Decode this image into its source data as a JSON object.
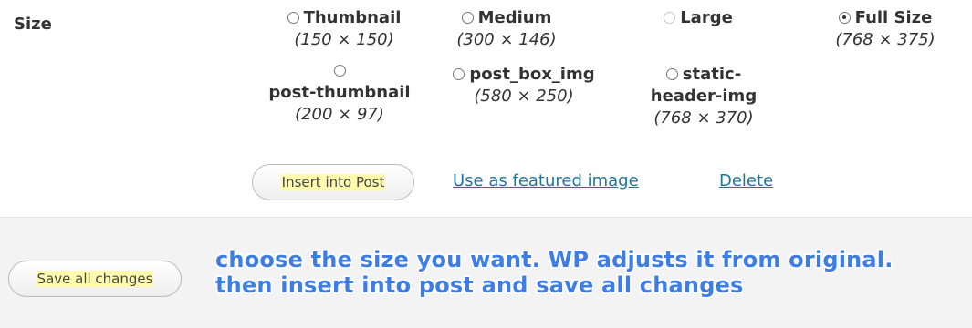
{
  "size_section": {
    "label": "Size",
    "options": [
      {
        "name": "Thumbnail",
        "dims": "(150 × 150)",
        "checked": false,
        "disabled": false
      },
      {
        "name": "Medium",
        "dims": "(300 × 146)",
        "checked": false,
        "disabled": false
      },
      {
        "name": "Large",
        "dims": "",
        "checked": false,
        "disabled": true
      },
      {
        "name": "Full Size",
        "dims": "(768 × 375)",
        "checked": true,
        "disabled": false
      },
      {
        "name": "post-thumbnail",
        "dims": "(200 × 97)",
        "checked": false,
        "disabled": false
      },
      {
        "name": "post_box_img",
        "dims": "(580 × 250)",
        "checked": false,
        "disabled": false
      },
      {
        "name_line1": "static-",
        "name_line2": "header-img",
        "dims": "(768 × 370)",
        "checked": false,
        "disabled": false
      }
    ]
  },
  "actions": {
    "insert_label": "Insert into Post",
    "featured_label": "Use as featured image",
    "delete_label": "Delete"
  },
  "footer": {
    "save_all_label": "Save all changes"
  },
  "annotation": {
    "line1": "choose the size you want. WP adjusts it from original.",
    "line2": "then insert into post and save all changes"
  },
  "colors": {
    "link": "#21759b",
    "annotation": "#3d7de6",
    "highlight": "#fffbae",
    "footer_bg": "#f3f3f3"
  }
}
